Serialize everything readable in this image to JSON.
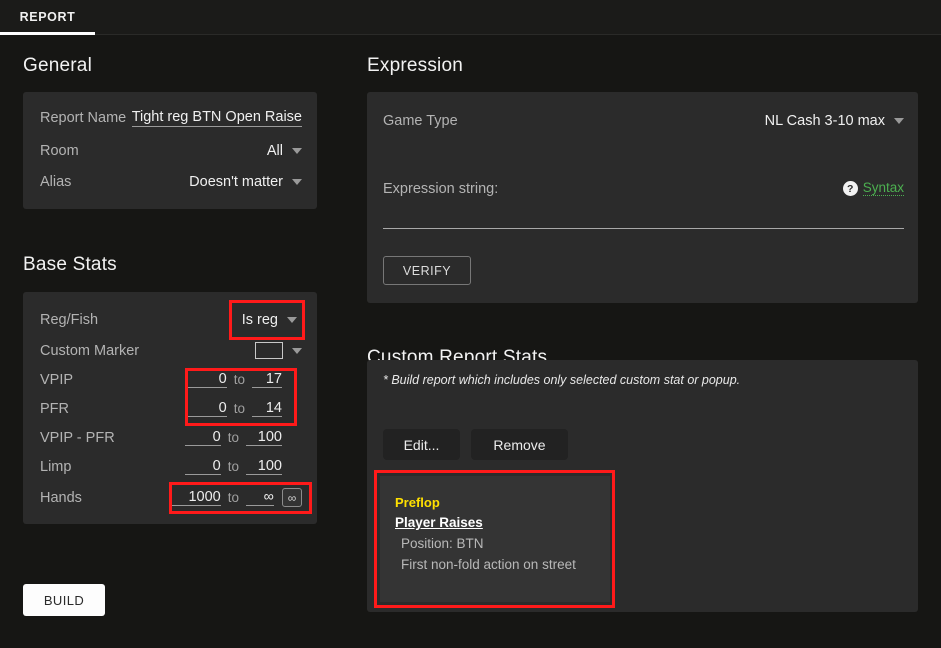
{
  "tabs": [
    {
      "label": "REPORT",
      "active": true
    }
  ],
  "sections": {
    "general": {
      "title": "General",
      "rows": [
        {
          "label": "Report Name",
          "value": "Tight reg BTN Open Raise",
          "type": "text"
        },
        {
          "label": "Room",
          "value": "All",
          "type": "dropdown"
        },
        {
          "label": "Alias",
          "value": "Doesn't matter",
          "type": "dropdown"
        }
      ]
    },
    "base_stats": {
      "title": "Base Stats",
      "rows": [
        {
          "label": "Reg/Fish",
          "value": "Is reg",
          "type": "dropdown"
        },
        {
          "label": "Custom Marker",
          "value": "",
          "type": "color-dropdown"
        },
        {
          "label": "VPIP",
          "min": "0",
          "to": "to",
          "max": "17",
          "type": "range"
        },
        {
          "label": "PFR",
          "min": "0",
          "to": "to",
          "max": "14",
          "type": "range"
        },
        {
          "label": "VPIP - PFR",
          "min": "0",
          "to": "to",
          "max": "100",
          "type": "range"
        },
        {
          "label": "Limp",
          "min": "0",
          "to": "to",
          "max": "100",
          "type": "range"
        },
        {
          "label": "Hands",
          "min": "1000",
          "to": "to",
          "max": "∞",
          "infinity_button": "∞",
          "type": "range-infinity"
        }
      ]
    },
    "expression": {
      "title": "Expression",
      "game_type_label": "Game Type",
      "game_type_value": "NL Cash 3-10 max",
      "expression_string_label": "Expression string:",
      "expression_string_value": "",
      "help_icon_glyph": "?",
      "syntax_link": "Syntax",
      "verify_button": "VERIFY"
    },
    "custom_report_stats": {
      "title": "Custom Report Stats",
      "note": "* Build report which includes only selected custom stat or popup.",
      "edit_button": "Edit...",
      "remove_button": "Remove",
      "selected_stat": {
        "street": "Preflop",
        "action": "Player Raises",
        "details": [
          "Position: BTN",
          "First non-fold action on street"
        ]
      }
    }
  },
  "build_button": "BUILD",
  "colors": {
    "background": "#161614",
    "panel": "#2b2b2b",
    "accent_highlight": "#ff1a1a",
    "link_green": "#4caf50",
    "street_yellow": "#ffe000",
    "build_button_bg": "#fdfdfd"
  }
}
